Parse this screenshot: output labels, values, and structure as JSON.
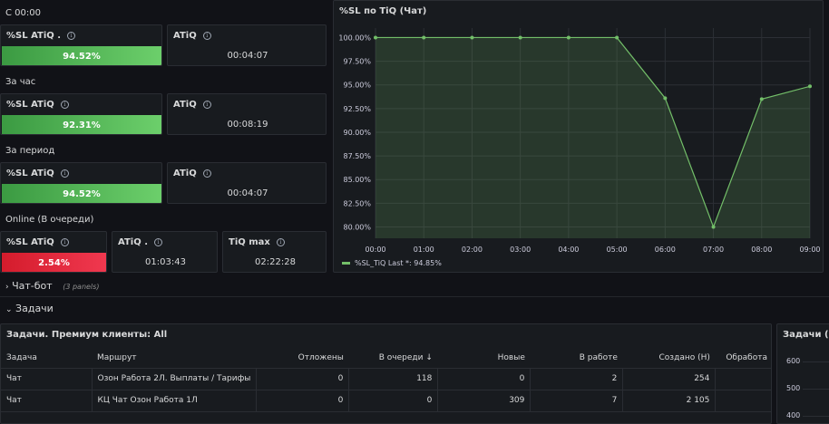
{
  "rows": {
    "since_midnight": "С 00:00",
    "per_hour": "За час",
    "per_period": "За период",
    "online": "Online (В очереди)"
  },
  "stats": {
    "r1_sl_title": "%SL ATiQ .",
    "r1_sl_value": "94.52%",
    "r1_sl_fill": 1.0,
    "r1_atiq_title": "ATiQ",
    "r1_atiq_value": "00:04:07",
    "r2_sl_title": "%SL ATiQ",
    "r2_sl_value": "92.31%",
    "r2_sl_fill": 1.0,
    "r2_atiq_title": "ATiQ",
    "r2_atiq_value": "00:08:19",
    "r3_sl_title": "%SL ATiQ",
    "r3_sl_value": "94.52%",
    "r3_sl_fill": 1.0,
    "r3_atiq_title": "ATiQ",
    "r3_atiq_value": "00:04:07",
    "r4_sl_title": "%SL ATiQ",
    "r4_sl_value": "2.54%",
    "r4_atiq_title": "ATiQ .",
    "r4_atiq_value": "01:03:43",
    "r4_tiq_title": "TiQ max",
    "r4_tiq_value": "02:22:28"
  },
  "chart_panel": {
    "title": "%SL по TiQ (Чат)",
    "legend": "%SL_TiQ   Last *: 94.85%"
  },
  "chart_data": {
    "type": "area",
    "title": "%SL по TiQ (Чат)",
    "x": [
      "00:00",
      "01:00",
      "02:00",
      "03:00",
      "04:00",
      "05:00",
      "06:00",
      "07:00",
      "08:00",
      "09:00"
    ],
    "series": [
      {
        "name": "%SL_TiQ",
        "values": [
          100.0,
          100.0,
          100.0,
          100.0,
          100.0,
          100.0,
          93.6,
          80.0,
          93.5,
          94.85
        ]
      }
    ],
    "yticks": [
      "100.00%",
      "97.50%",
      "95.00%",
      "92.50%",
      "90.00%",
      "87.50%",
      "85.00%",
      "82.50%",
      "80.00%"
    ],
    "ylim": [
      78.8,
      101.0
    ],
    "grid": true,
    "color": "#73bf69"
  },
  "sections": {
    "chatbot": "Чат-бот",
    "chatbot_note": "(3 panels)",
    "tasks": "Задачи"
  },
  "table_panel": {
    "title": "Задачи. Премиум клиенты: All",
    "columns": [
      "Задача",
      "Маршрут",
      "Отложены",
      "В очереди",
      "Новые",
      "В работе",
      "Создано (Н)",
      "Обработа"
    ],
    "rows": [
      [
        "Чат",
        "Озон Работа 2Л. Выплаты / Тарифы",
        "0",
        "118",
        "0",
        "2",
        "254",
        ""
      ],
      [
        "Чат",
        "КЦ Чат Озон Работа 1Л",
        "0",
        "0",
        "309",
        "7",
        "2 105",
        ""
      ]
    ]
  },
  "right_panel": {
    "title": "Задачи (Ча",
    "yticks": [
      "600",
      "500",
      "400"
    ]
  }
}
